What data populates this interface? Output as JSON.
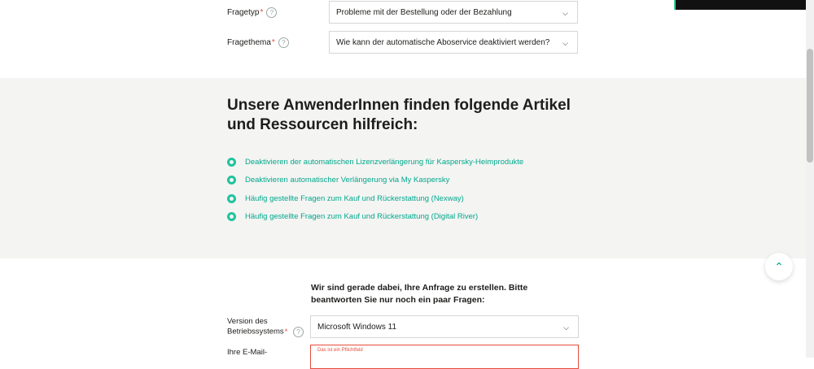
{
  "form_top": {
    "fragetyp": {
      "label": "Fragetyp",
      "value": "Probleme mit der Bestellung oder der Bezahlung"
    },
    "fragethema": {
      "label": "Fragethema",
      "value": "Wie kann der automatische Aboservice deaktiviert werden?"
    },
    "required_mark": "*",
    "help_glyph": "?"
  },
  "help_section": {
    "title": "Unsere AnwenderInnen finden folgende Artikel und Ressourcen hilfreich:",
    "links": [
      "Deaktivieren der automatischen Lizenzverlängerung für Kaspersky-Heimprodukte",
      "Deaktivieren automatischer Verlängerung via My Kaspersky",
      "Häufig gestellte Fragen zum Kauf und Rückerstattung (Nexway)",
      "Häufig gestellte Fragen zum Kauf und Rückerstattung (Digital River)"
    ]
  },
  "form_bottom": {
    "heading": "Wir sind gerade dabei, Ihre Anfrage zu erstellen. Bitte beantworten Sie nur noch ein paar Fragen:",
    "os": {
      "label": "Version des Betriebssystems",
      "value": "Microsoft Windows 11"
    },
    "email": {
      "label": "Ihre E-Mail-",
      "error": "Das ist ein Pflichtfeld"
    }
  },
  "icons": {
    "chevron": "chevron-down-icon",
    "up": "chevron-up-icon",
    "bullet": "circle-bullet-icon"
  },
  "colors": {
    "accent": "#00a88e",
    "error": "#e64c3c",
    "section_bg": "#f4f4f2"
  }
}
